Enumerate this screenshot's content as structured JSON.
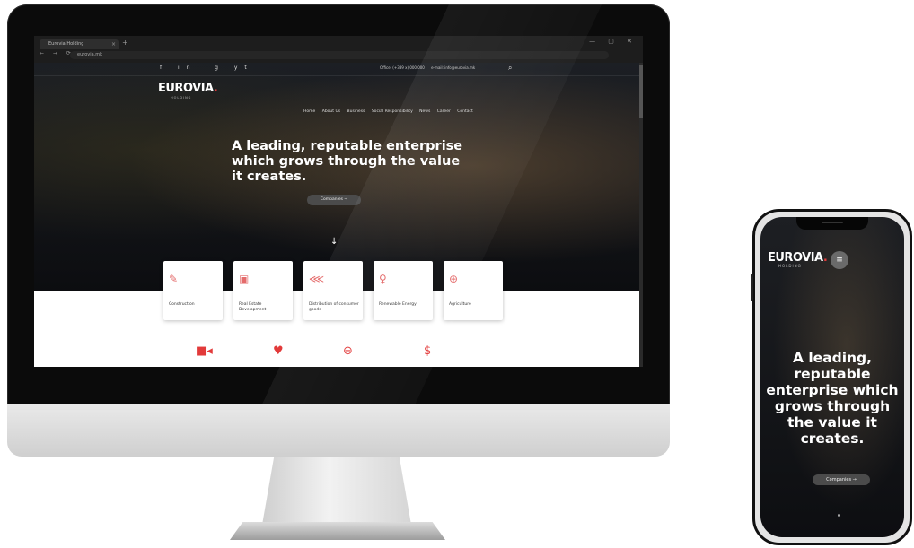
{
  "browser": {
    "tab_title": "Eurovia Holding",
    "tab_close": "×",
    "new_tab": "+",
    "window_controls": "— ▢ ✕",
    "nav_arrows": "← → ⟳",
    "address": "eurovia.mk"
  },
  "site": {
    "social_icons": [
      "f",
      "in",
      "ig",
      "yt"
    ],
    "office_phone": "Office: (+389 x) 000 000",
    "email": "e-mail: info@eurovia.mk",
    "logo_text": "EUROVIA",
    "logo_sub": "HOLDING",
    "menu": [
      "Home",
      "About Us",
      "Business",
      "Social Responsibility",
      "News",
      "Career",
      "Contact"
    ],
    "headline": "A leading, reputable enterprise which grows through the value it creates.",
    "cta_label": "Companies →",
    "scroll_arrow": "↓",
    "cards": [
      {
        "icon": "edit-icon",
        "glyph": "✎",
        "label": "Construction"
      },
      {
        "icon": "building-icon",
        "glyph": "▣",
        "label": "Real Estate Development"
      },
      {
        "icon": "share-icon",
        "glyph": "⋘",
        "label": "Distribution of consumer goods"
      },
      {
        "icon": "bulb-icon",
        "glyph": "♀",
        "label": "Renewable Energy"
      },
      {
        "icon": "globe-icon",
        "glyph": "⊕",
        "label": "Agriculture"
      }
    ],
    "bottom_icons": [
      {
        "icon": "camera-icon",
        "glyph": "■◂"
      },
      {
        "icon": "heart-icon",
        "glyph": "♥"
      },
      {
        "icon": "ticket-icon",
        "glyph": "⊖"
      },
      {
        "icon": "dollar-icon",
        "glyph": "$"
      }
    ]
  },
  "phone": {
    "logo_text": "EUROVIA",
    "logo_sub": "HOLDING",
    "menu_glyph": "≡",
    "headline": "A leading, reputable enterprise which grows through the value it creates.",
    "cta_label": "Companies →"
  },
  "colors": {
    "accent": "#e23a3a",
    "hero_dark": "#111111",
    "card_bg": "#ffffff"
  }
}
